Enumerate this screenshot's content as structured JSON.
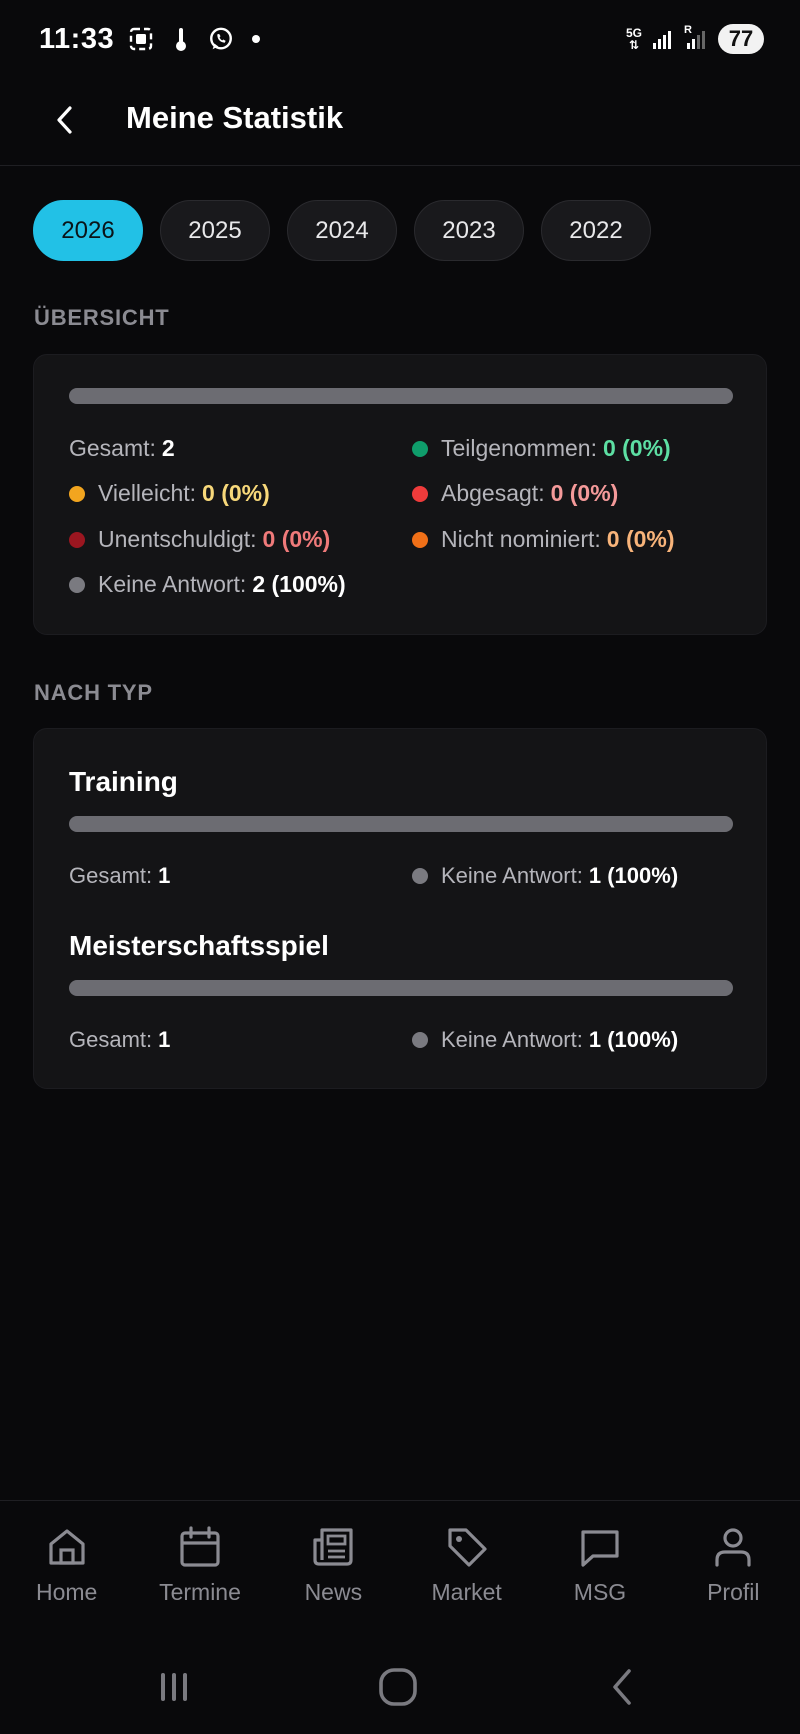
{
  "status_bar": {
    "time": "11:33",
    "network": "5G",
    "roaming": "R",
    "battery": "77"
  },
  "header": {
    "title": "Meine Statistik"
  },
  "years": {
    "items": [
      "2026",
      "2025",
      "2024",
      "2023",
      "2022"
    ],
    "selected": "2026"
  },
  "overview": {
    "label": "ÜBERSICHT",
    "total_label": "Gesamt:",
    "total_value": "2",
    "progress_fraction": 1.0,
    "stats": [
      {
        "label": "Teilgenommen:",
        "value": "0 (0%)",
        "dot_color": "#0f9d6b",
        "value_color": "#5ddfa3"
      },
      {
        "label": "Vielleicht:",
        "value": "0 (0%)",
        "dot_color": "#f2a51f",
        "value_color": "#f7d87a"
      },
      {
        "label": "Abgesagt:",
        "value": "0 (0%)",
        "dot_color": "#ef3b3b",
        "value_color": "#f59a9a"
      },
      {
        "label": "Unentschuldigt:",
        "value": "0 (0%)",
        "dot_color": "#9b1620",
        "value_color": "#f07a7a"
      },
      {
        "label": "Nicht nominiert:",
        "value": "0 (0%)",
        "dot_color": "#f07018",
        "value_color": "#f8b47a"
      },
      {
        "label": "Keine Antwort:",
        "value": "2 (100%)",
        "dot_color": "#7a7a80",
        "value_color": "#ffffff"
      }
    ]
  },
  "by_type": {
    "label": "NACH TYP",
    "types": [
      {
        "title": "Training",
        "total_label": "Gesamt:",
        "total_value": "1",
        "progress_fraction": 1.0,
        "stat_label": "Keine Antwort:",
        "stat_value": "1 (100%)",
        "dot_color": "#7a7a80"
      },
      {
        "title": "Meisterschaftsspiel",
        "total_label": "Gesamt:",
        "total_value": "1",
        "progress_fraction": 1.0,
        "stat_label": "Keine Antwort:",
        "stat_value": "1 (100%)",
        "dot_color": "#7a7a80"
      }
    ]
  },
  "bottom_nav": {
    "items": [
      {
        "label": "Home",
        "icon": "home-icon"
      },
      {
        "label": "Termine",
        "icon": "calendar-icon"
      },
      {
        "label": "News",
        "icon": "newspaper-icon"
      },
      {
        "label": "Market",
        "icon": "tag-icon"
      },
      {
        "label": "MSG",
        "icon": "message-icon"
      },
      {
        "label": "Profil",
        "icon": "user-icon"
      }
    ]
  },
  "colors": {
    "accent": "#22c1e6",
    "background": "#09090b",
    "card": "#141416",
    "muted_text": "#8b8b92"
  }
}
